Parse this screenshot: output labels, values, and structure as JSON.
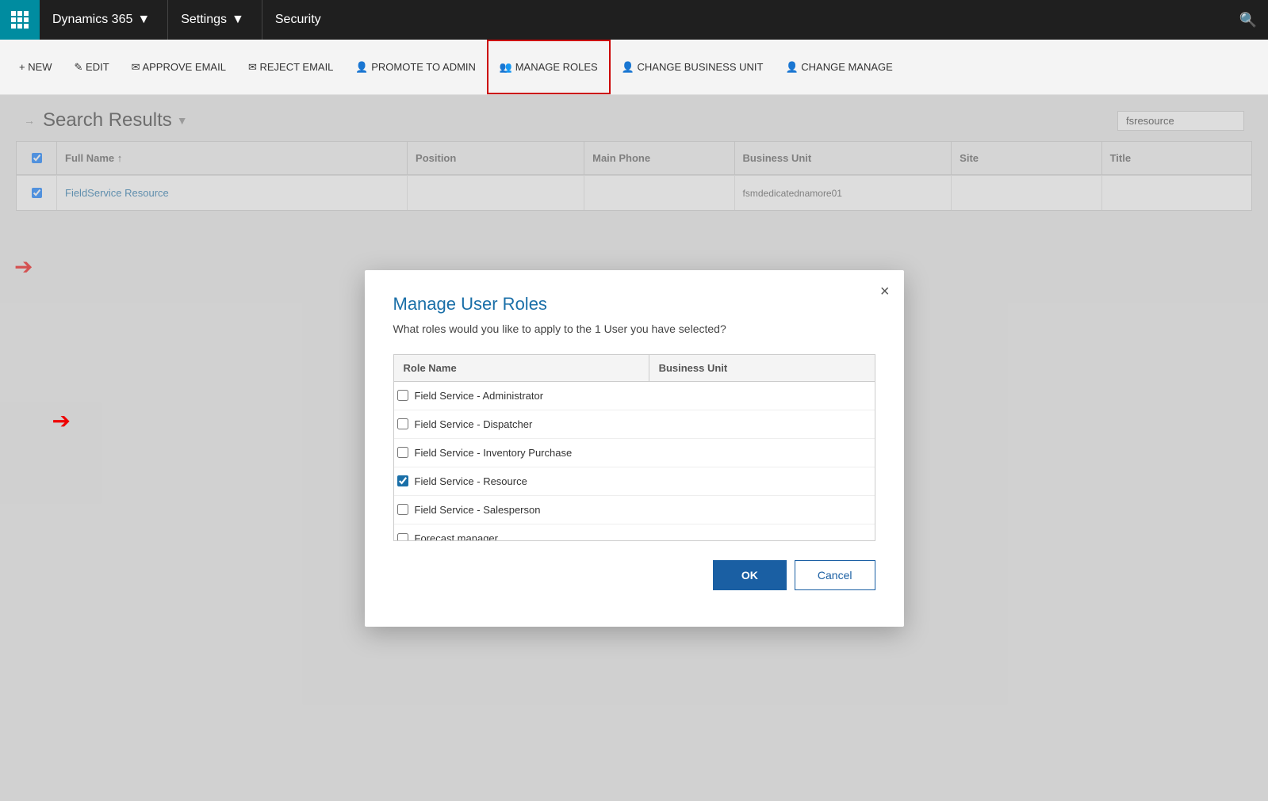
{
  "nav": {
    "brand": "Dynamics 365",
    "settings": "Settings",
    "module": "Security"
  },
  "toolbar": {
    "new_label": "+ NEW",
    "edit_label": "✎ EDIT",
    "approve_email_label": "✉ APPROVE EMAIL",
    "reject_email_label": "✉ REJECT EMAIL",
    "promote_label": "👤 PROMOTE TO ADMIN",
    "manage_roles_label": "👥 MANAGE ROLES",
    "change_bu_label": "👤 CHANGE BUSINESS UNIT",
    "change_manage_label": "👤 CHANGE MANAGE"
  },
  "content": {
    "title": "Search Results",
    "search_placeholder": "fsresource"
  },
  "table": {
    "columns": [
      "Full Name",
      "Position",
      "Main Phone",
      "Business Unit",
      "Site",
      "Title"
    ],
    "rows": [
      {
        "name": "FieldService Resource",
        "position": "",
        "phone": "",
        "bu": "fsmdedicatednamore01",
        "site": "",
        "title": ""
      }
    ]
  },
  "modal": {
    "title": "Manage User Roles",
    "subtitle": "What roles would you like to apply to the 1 User you have selected?",
    "col_role": "Role Name",
    "col_bu": "Business Unit",
    "roles": [
      {
        "name": "Field Service - Administrator",
        "checked": false
      },
      {
        "name": "Field Service - Dispatcher",
        "checked": false
      },
      {
        "name": "Field Service - Inventory Purchase",
        "checked": false
      },
      {
        "name": "Field Service - Resource",
        "checked": true
      },
      {
        "name": "Field Service - Salesperson",
        "checked": false
      },
      {
        "name": "Forecast manager",
        "checked": false
      }
    ],
    "ok_label": "OK",
    "cancel_label": "Cancel",
    "close_label": "×"
  }
}
